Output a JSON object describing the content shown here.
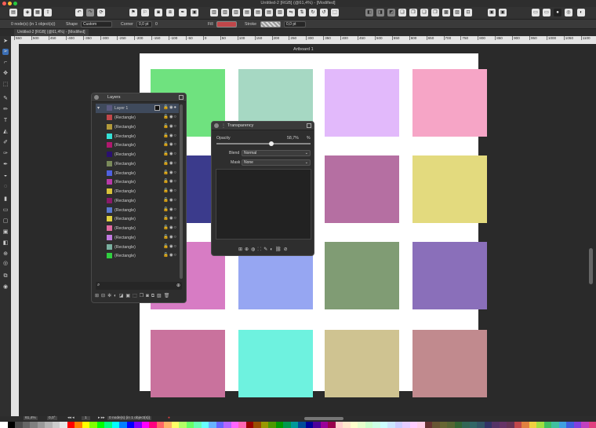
{
  "window": {
    "title": "Untitled-2 [RGB] (@61,4%) - [Modified]"
  },
  "context_bar": {
    "selection_info": "0 node(s) (in 1 object(s))",
    "shape_label": "Shape",
    "shape_value": "Custom",
    "corner_label": "Corner",
    "corner_value": "0,0 pt",
    "corner_extra": "0",
    "fill_label": "Fill",
    "fill_color": "#c0474a",
    "stroke_label": "Stroke",
    "stroke_value": "0,0 pt"
  },
  "document_tab": {
    "label": "Untitled-2 [RGB] (@61,4%) - [Modified]"
  },
  "ruler": {
    "ticks": [
      "550",
      "500",
      "450",
      "-400",
      "-350",
      "-300",
      "-250",
      "-200",
      "-150",
      "-100",
      "-50",
      "0",
      "50",
      "100",
      "150",
      "200",
      "250",
      "300",
      "350",
      "400",
      "450",
      "500",
      "550",
      "600",
      "650",
      "700",
      "750",
      "800",
      "850",
      "900",
      "950",
      "1000",
      "1050",
      "1100",
      "1150"
    ]
  },
  "artboard": {
    "label": "Artboard 1"
  },
  "canvas_rects": [
    {
      "color": "#6fe27f",
      "opacity": 1
    },
    {
      "color": "#a6d8c3",
      "opacity": 1
    },
    {
      "color": "#e2b9fb",
      "opacity": 1
    },
    {
      "color": "#f6a5c6",
      "opacity": 1
    },
    {
      "color": "#ecdc84",
      "opacity": 1
    },
    {
      "color": "#3b3b8c",
      "opacity": 1
    },
    {
      "color": "#b56fa2",
      "opacity": 1
    },
    {
      "color": "#e3da7e",
      "opacity": 1
    },
    {
      "color": "#d77cc4",
      "opacity": 1
    },
    {
      "color": "#96a6f2",
      "opacity": 1
    },
    {
      "color": "#809c74",
      "opacity": 1
    },
    {
      "color": "#8a6fba",
      "opacity": 1
    },
    {
      "color": "#c9729d",
      "opacity": 1
    },
    {
      "color": "#6ef2df",
      "opacity": 1
    },
    {
      "color": "#cfc391",
      "opacity": 1
    },
    {
      "color": "#c18a8e",
      "opacity": 1
    }
  ],
  "layers_panel": {
    "title": "Layers",
    "parent": {
      "name": "Layer 1"
    },
    "items": [
      {
        "name": "(Rectangle)",
        "color": "#c0474a"
      },
      {
        "name": "(Rectangle)",
        "color": "#b39a3a"
      },
      {
        "name": "(Rectangle)",
        "color": "#35e0d6"
      },
      {
        "name": "(Rectangle)",
        "color": "#b0186e"
      },
      {
        "name": "(Rectangle)",
        "color": "#2a1070"
      },
      {
        "name": "(Rectangle)",
        "color": "#7a8a5a"
      },
      {
        "name": "(Rectangle)",
        "color": "#4f61e0"
      },
      {
        "name": "(Rectangle)",
        "color": "#b83aa8"
      },
      {
        "name": "(Rectangle)",
        "color": "#d8c23a"
      },
      {
        "name": "(Rectangle)",
        "color": "#8a1a6a"
      },
      {
        "name": "(Rectangle)",
        "color": "#5a7ad0"
      },
      {
        "name": "(Rectangle)",
        "color": "#e0d040"
      },
      {
        "name": "(Rectangle)",
        "color": "#e06aa0"
      },
      {
        "name": "(Rectangle)",
        "color": "#c07ae0"
      },
      {
        "name": "(Rectangle)",
        "color": "#7ab0a0"
      },
      {
        "name": "(Rectangle)",
        "color": "#30d040"
      }
    ]
  },
  "transparency_panel": {
    "title": "Transparency",
    "opacity_label": "Opacity",
    "opacity_value": "58,7%",
    "opacity_unit": "%",
    "opacity_fraction": 0.587,
    "blend_label": "Blend",
    "blend_value": "Normal",
    "mask_label": "Mask",
    "mask_value": "None"
  },
  "status_bar": {
    "zoom": "61,4%",
    "rotation": "0,0°",
    "page": "1",
    "selection_info": "0 node(s) (in 1 object(s))"
  },
  "palette": [
    "#ffffff",
    "#000000",
    "#4d4d4d",
    "#666666",
    "#808080",
    "#999999",
    "#b3b3b3",
    "#cccccc",
    "#e6e6e6",
    "#ff0000",
    "#ff8000",
    "#ffff00",
    "#80ff00",
    "#00ff00",
    "#00ff80",
    "#00ffff",
    "#0080ff",
    "#0000ff",
    "#8000ff",
    "#ff00ff",
    "#ff0080",
    "#ff6666",
    "#ffb366",
    "#ffff66",
    "#b3ff66",
    "#66ff66",
    "#66ffb3",
    "#66ffff",
    "#66b3ff",
    "#6666ff",
    "#b366ff",
    "#ff66ff",
    "#ff66b3",
    "#990000",
    "#994d00",
    "#999900",
    "#4d9900",
    "#009900",
    "#00994d",
    "#009999",
    "#004d99",
    "#000099",
    "#4d0099",
    "#990099",
    "#99004d",
    "#ffcccc",
    "#ffe6cc",
    "#ffffcc",
    "#e6ffcc",
    "#ccffcc",
    "#ccffe6",
    "#ccffff",
    "#cce6ff",
    "#ccccff",
    "#e6ccff",
    "#ffccff",
    "#ffcce6",
    "#663333",
    "#665533",
    "#666633",
    "#556633",
    "#336633",
    "#336655",
    "#336666",
    "#335566",
    "#333366",
    "#553366",
    "#663366",
    "#663355",
    "#c0474a",
    "#e08040",
    "#f0d040",
    "#a0e040",
    "#40c060",
    "#40c0a0",
    "#40a0e0",
    "#4060e0",
    "#8040e0",
    "#c040c0",
    "#e04080"
  ]
}
